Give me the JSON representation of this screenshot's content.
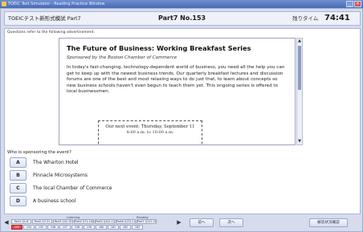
{
  "window": {
    "title": "TOEIC Test Simulator - Reading Practice Window"
  },
  "header": {
    "test_name": "TOEICテスト新形式模試 Part7",
    "part_label": "Part7 No.153",
    "timer_label": "残りタイム",
    "timer_value": "74:41"
  },
  "passage": {
    "directions": "Questions refer to the following advertisement.",
    "title": "The Future of Business: Working Breakfast Series",
    "sponsor": "Sponsored by the Boston Chamber of Commerce",
    "body": "In today's fast-changing, technology-dependent world of business, you need all the help you can get to keep up with the newest business trends. Our quarterly breakfast lectures and discussion forums are one of the best and most relaxing ways to do just that, to learn about concepts so new business schools haven't even begun to teach them yet. This ongoing series is offered to local businessmen.",
    "event_line1": "Our next event: Thursday, September 11",
    "event_line2": "8:00 a.m. to 10:00 a.m."
  },
  "question": {
    "text": "Who is sponsoring the event?",
    "options": [
      {
        "letter": "A",
        "text": "The Wharton Hotel"
      },
      {
        "letter": "B",
        "text": "Pinnacle Microsystems"
      },
      {
        "letter": "C",
        "text": "The local Chamber of Commerce"
      },
      {
        "letter": "D",
        "text": "A business school"
      }
    ]
  },
  "footer": {
    "listening_label": "Listening",
    "reading_label": "Reading",
    "parts": [
      "Part1 Q1-6",
      "Part2 Q7-31",
      "Part3 Q32-70",
      "Part4 Q71-100",
      "Part5 Q101-130",
      "Part6 Q131-146",
      "Part7 Q147-200"
    ],
    "question_numbers": [
      "153",
      "154",
      "155",
      "156",
      "157",
      "158",
      "159",
      "160",
      "161",
      "162",
      "163"
    ],
    "prev_label": "前へ",
    "next_label": "次へ",
    "finish_label": "解答状況確認"
  },
  "colors": {
    "current_question": "#e14848",
    "titlebar": "#4a6bb6",
    "panel": "#d6dcec"
  }
}
